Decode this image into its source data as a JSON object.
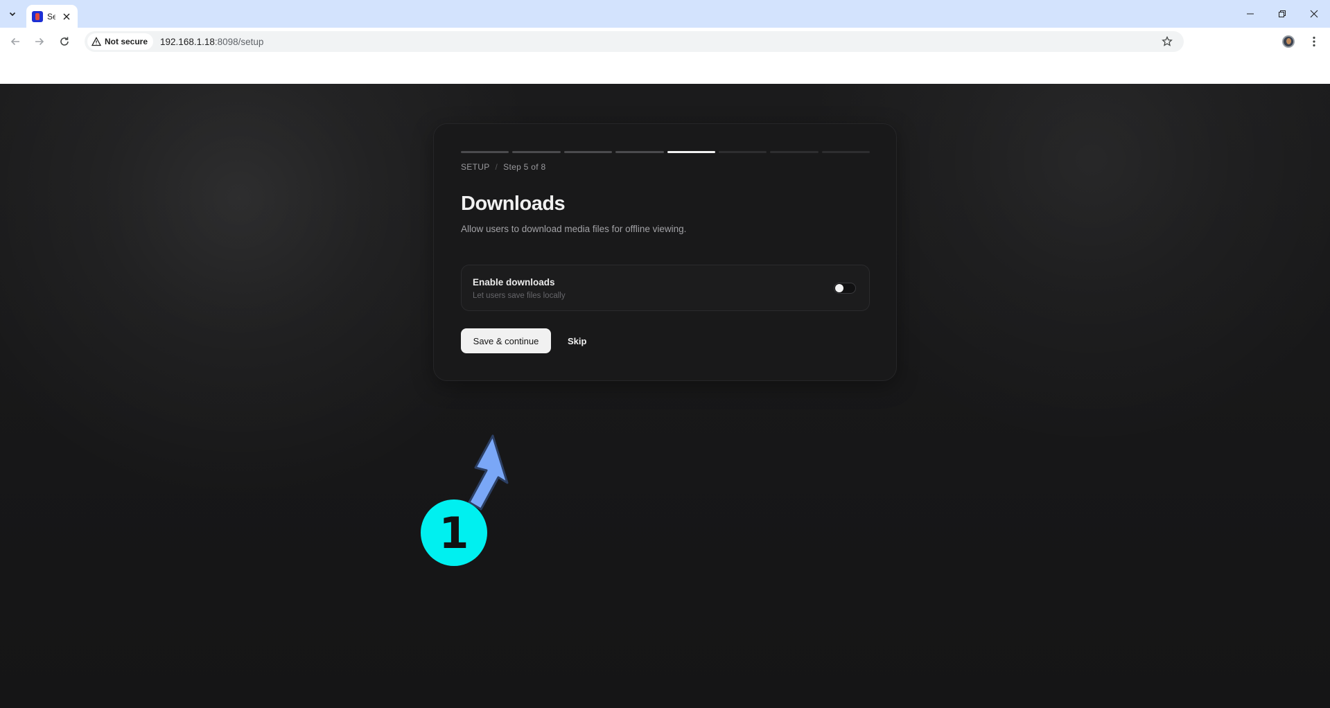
{
  "browser": {
    "tab_title": "Se",
    "security_label": "Not secure",
    "url_host": "192.168.1.18",
    "url_path": ":8098/setup"
  },
  "setup": {
    "progress": {
      "total_steps": 8,
      "current_step": 5
    },
    "breadcrumb_section": "SETUP",
    "breadcrumb_separator": "/",
    "breadcrumb_step": "Step 5 of 8",
    "title": "Downloads",
    "subtitle": "Allow users to download media files for offline viewing.",
    "option": {
      "title": "Enable downloads",
      "description": "Let users save files locally",
      "enabled": false
    },
    "save_label": "Save & continue",
    "skip_label": "Skip"
  },
  "annotation": {
    "badge_number": "1",
    "color": "#00f0f0",
    "arrow_color": "#7aa7f7"
  },
  "colors": {
    "chrome_tabstrip": "#d3e3fd",
    "page_background": "#161617",
    "card_background": "#19191a",
    "primary_button": "#f1f1f1"
  },
  "icons": [
    "tab-list-icon",
    "close-icon",
    "minimize-icon",
    "restore-icon",
    "back-icon",
    "forward-icon",
    "reload-icon",
    "warning-icon",
    "star-icon",
    "kebab-menu-icon"
  ]
}
